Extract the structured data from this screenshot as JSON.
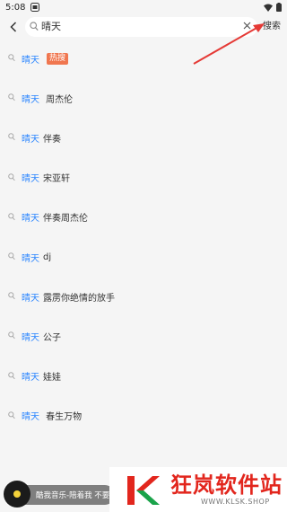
{
  "status_bar": {
    "time": "5:08"
  },
  "search": {
    "query": "晴天",
    "submit_label": "搜索"
  },
  "suggestions": [
    {
      "highlight": "晴天",
      "rest": "",
      "badge": "热搜"
    },
    {
      "highlight": "晴天",
      "rest": " 周杰伦",
      "badge": ""
    },
    {
      "highlight": "晴天",
      "rest": "伴奏",
      "badge": ""
    },
    {
      "highlight": "晴天",
      "rest": "宋亚轩",
      "badge": ""
    },
    {
      "highlight": "晴天",
      "rest": "伴奏周杰伦",
      "badge": ""
    },
    {
      "highlight": "晴天",
      "rest": "dj",
      "badge": ""
    },
    {
      "highlight": "晴天",
      "rest": "露雳你绝情的放手",
      "badge": ""
    },
    {
      "highlight": "晴天",
      "rest": "公子",
      "badge": ""
    },
    {
      "highlight": "晴天",
      "rest": "娃娃",
      "badge": ""
    },
    {
      "highlight": "晴天",
      "rest": " 春生万物",
      "badge": ""
    }
  ],
  "player": {
    "text": "酷我音乐-陪着我 不要"
  },
  "watermark": {
    "name": "狂岚软件站",
    "url": "WWW.KLSK.SHOP"
  },
  "colors": {
    "highlight": "#2a85ff",
    "badge": "#f0764f",
    "annotation": "#e53935",
    "watermark": "#e2261d"
  }
}
